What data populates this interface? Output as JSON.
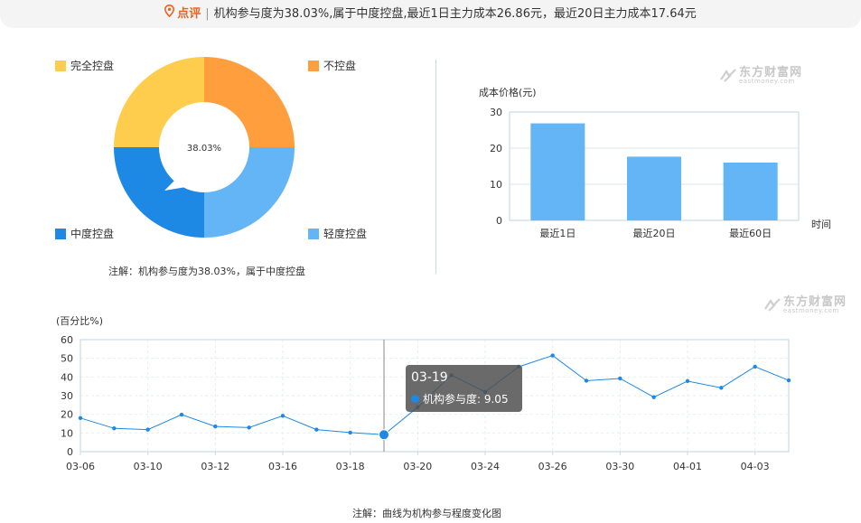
{
  "header": {
    "tag": "点评",
    "separator": "|",
    "text": "机构参与度为38.03%,属于中度控盘,最近1日主力成本26.86元，最近20日主力成本17.64元"
  },
  "watermark": {
    "cn": "东方财富网",
    "en": "eastmoney.com"
  },
  "colors": {
    "full_control": "#ffcd4d",
    "no_control": "#ff9e3d",
    "medium_control": "#1e88e5",
    "light_control": "#64b5f6",
    "bar": "#64b5f6",
    "line": "#1e88e5",
    "axis": "#c9dbe8"
  },
  "pie_notes": {
    "note": "注解：机构参与度为38.03%，属于中度控盘"
  },
  "line_notes": {
    "note": "注解：曲线为机构参与程度变化图"
  },
  "tooltip": {
    "date": "03-19",
    "label": "机构参与度: 9.05"
  },
  "chart_data": [
    {
      "type": "pie",
      "variant": "donut",
      "center_label": "38.03%",
      "slices": [
        {
          "label": "不控盘",
          "value": 25,
          "color": "#ff9e3d"
        },
        {
          "label": "轻度控盘",
          "value": 25,
          "color": "#64b5f6"
        },
        {
          "label": "中度控盘",
          "value": 25,
          "color": "#1e88e5"
        },
        {
          "label": "完全控盘",
          "value": 25,
          "color": "#ffcd4d"
        }
      ],
      "pointer_slice": "中度控盘",
      "legend": [
        "完全控盘",
        "不控盘",
        "中度控盘",
        "轻度控盘"
      ]
    },
    {
      "type": "bar",
      "categories": [
        "最近1日",
        "最近20日",
        "最近60日"
      ],
      "values": [
        26.86,
        17.64,
        16.0
      ],
      "ylabel": "成本价格(元)",
      "xlabel": "时间",
      "ylim": [
        0,
        30
      ],
      "yticks": [
        "0",
        "10",
        "20",
        "30"
      ]
    },
    {
      "type": "line",
      "ylabel": "(百分比%)",
      "ylim": [
        0,
        60
      ],
      "yticks": [
        "0",
        "10",
        "20",
        "30",
        "40",
        "50",
        "60"
      ],
      "x": [
        "03-06",
        "03-09",
        "03-10",
        "03-11",
        "03-12",
        "03-13",
        "03-16",
        "03-17",
        "03-18",
        "03-19",
        "03-20",
        "03-23",
        "03-24",
        "03-25",
        "03-26",
        "03-27",
        "03-30",
        "03-31",
        "04-01",
        "04-02",
        "04-03",
        "04-06"
      ],
      "x_tick_labels": [
        "03-06",
        "03-10",
        "03-12",
        "03-16",
        "03-18",
        "03-20",
        "03-24",
        "03-26",
        "03-30",
        "04-01",
        "04-03"
      ],
      "series": [
        {
          "name": "机构参与度",
          "values": [
            18,
            12.5,
            11.8,
            19.8,
            13.5,
            12.9,
            19.2,
            11.8,
            10.2,
            9.05,
            23.8,
            41,
            32,
            45.5,
            51.5,
            38,
            39.2,
            29.2,
            37.8,
            34.2,
            45.5,
            38.2
          ]
        }
      ],
      "highlight": "03-19",
      "grid": true
    }
  ]
}
